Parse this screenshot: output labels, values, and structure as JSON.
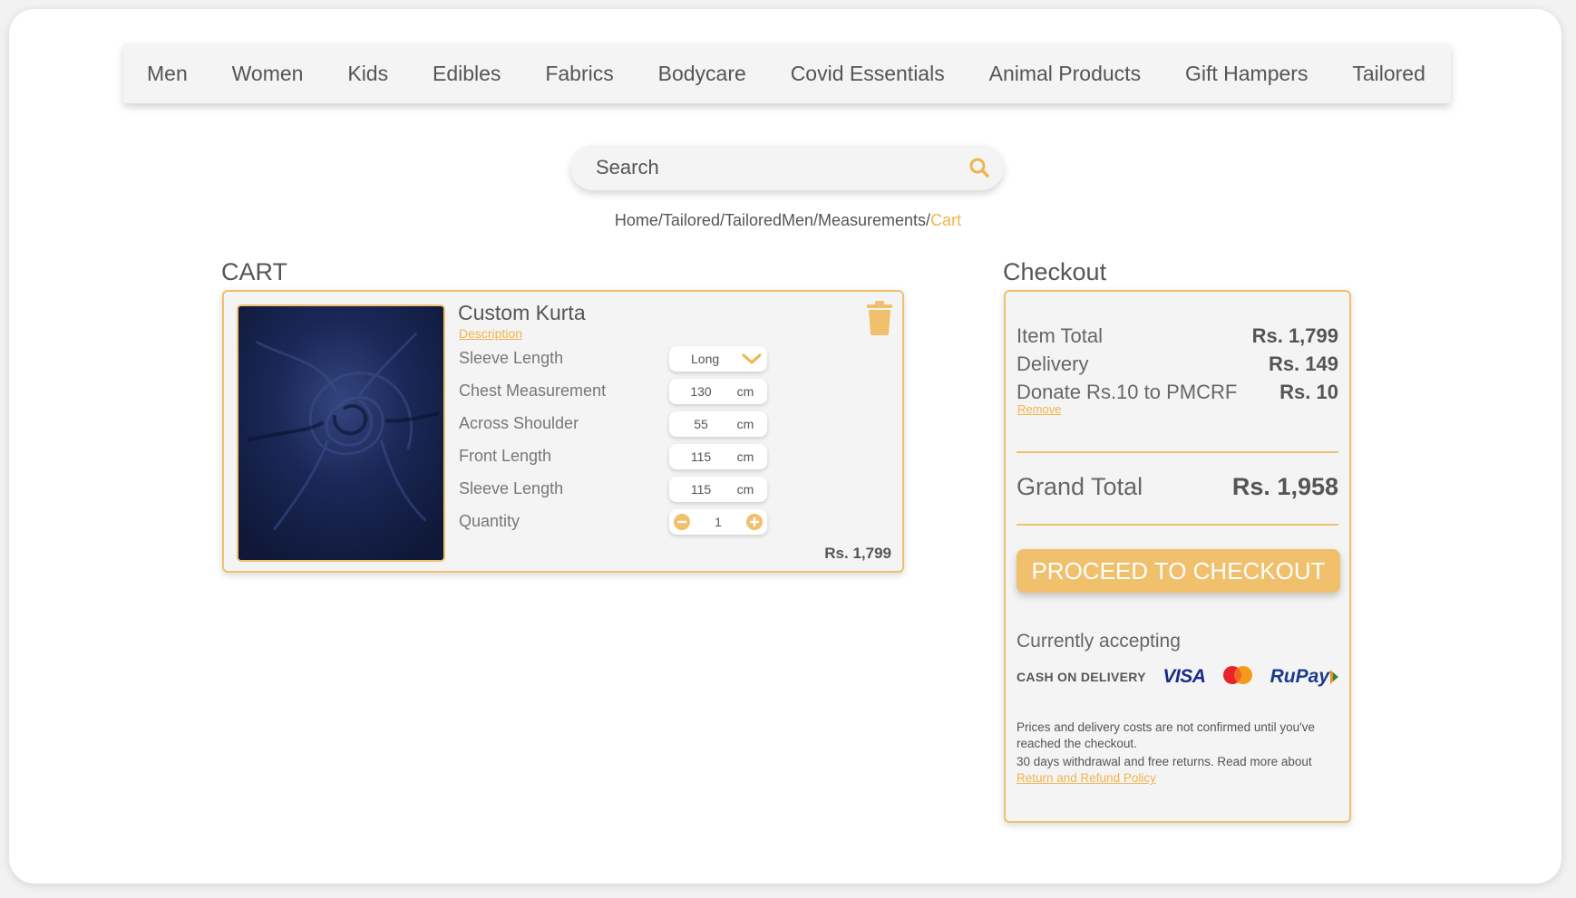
{
  "nav": {
    "items": [
      "Men",
      "Women",
      "Kids",
      "Edibles",
      "Fabrics",
      "Bodycare",
      "Covid Essentials",
      "Animal Products",
      "Gift Hampers",
      "Tailored"
    ]
  },
  "search": {
    "placeholder": "Search",
    "icon": "search-icon"
  },
  "breadcrumb": {
    "path": "Home/Tailored/TailoredMen/Measurements/",
    "current": "Cart"
  },
  "cart": {
    "title": "CART",
    "item": {
      "name": "Custom Kurta",
      "description_link": "Description",
      "price": "Rs. 1,799",
      "rows": [
        {
          "label": "Sleeve Length",
          "value": "Long",
          "type": "select"
        },
        {
          "label": "Chest Measurement",
          "value": "130",
          "unit": "cm"
        },
        {
          "label": "Across Shoulder",
          "value": "55",
          "unit": "cm"
        },
        {
          "label": "Front Length",
          "value": "115",
          "unit": "cm"
        },
        {
          "label": "Sleeve Length",
          "value": "115",
          "unit": "cm"
        },
        {
          "label": "Quantity",
          "value": "1",
          "type": "stepper"
        }
      ]
    }
  },
  "checkout": {
    "title": "Checkout",
    "item_total_label": "Item Total",
    "item_total_value": "Rs. 1,799",
    "delivery_label": "Delivery",
    "delivery_value": "Rs. 149",
    "donate_label": "Donate Rs.10 to PMCRF",
    "donate_value": "Rs. 10",
    "remove_link": "Remove",
    "grand_total_label": "Grand Total",
    "grand_total_value": "Rs. 1,958",
    "cta": "PROCEED TO CHECKOUT",
    "accepting_label": "Currently accepting",
    "payment_methods": [
      "CASH ON DELIVERY",
      "VISA",
      "Mastercard",
      "RuPay"
    ],
    "note1": "Prices and delivery costs are not confirmed until you've reached the checkout.",
    "note2": "30 days withdrawal and free returns. Read more about",
    "policy_link": "Return and Refund Policy"
  },
  "colors": {
    "accent": "#f1c06c",
    "accent_text": "#f1b44c",
    "text": "#555555",
    "card_bg": "#f4f4f4"
  }
}
